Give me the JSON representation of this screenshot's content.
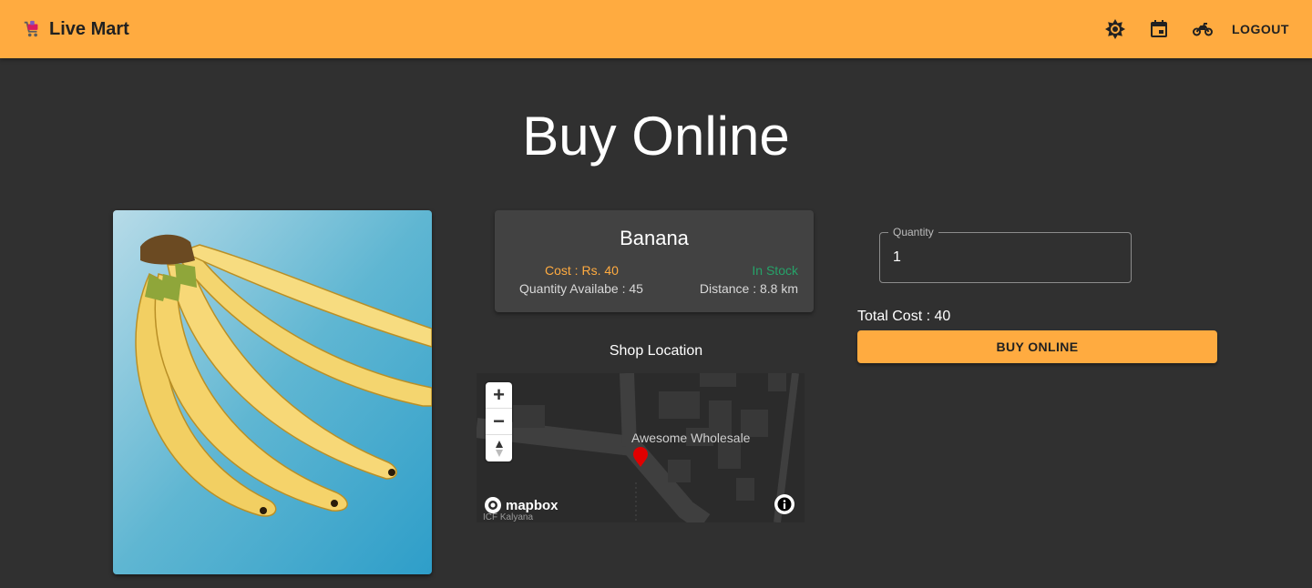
{
  "app": {
    "title": "Live Mart",
    "logo_icon": "shopping-cart-icon"
  },
  "header": {
    "icons": [
      "brightness-icon",
      "calendar-icon",
      "delivery-bike-icon"
    ],
    "logout_label": "LOGOUT"
  },
  "page": {
    "title": "Buy Online"
  },
  "product": {
    "name": "Banana",
    "cost": "Cost : Rs. 40",
    "quantity_available": "Quantity Availabe : 45",
    "stock_status": "In Stock",
    "distance": "Distance : 8.8 km",
    "image_subject": "banana bunch on blue background"
  },
  "map": {
    "section_label": "Shop Location",
    "marker_label": "Awesome Wholesale",
    "place_label": "ICF Kalyana",
    "attribution": "mapbox",
    "zoom_in": "+",
    "zoom_out": "−"
  },
  "order": {
    "quantity_label": "Quantity",
    "quantity_value": "1",
    "total_cost": "Total Cost : 40",
    "buy_label": "BUY ONLINE"
  },
  "colors": {
    "accent": "#ffab40",
    "background": "#303030",
    "card": "#424242",
    "in_stock": "#26a269",
    "marker": "#e00000"
  }
}
